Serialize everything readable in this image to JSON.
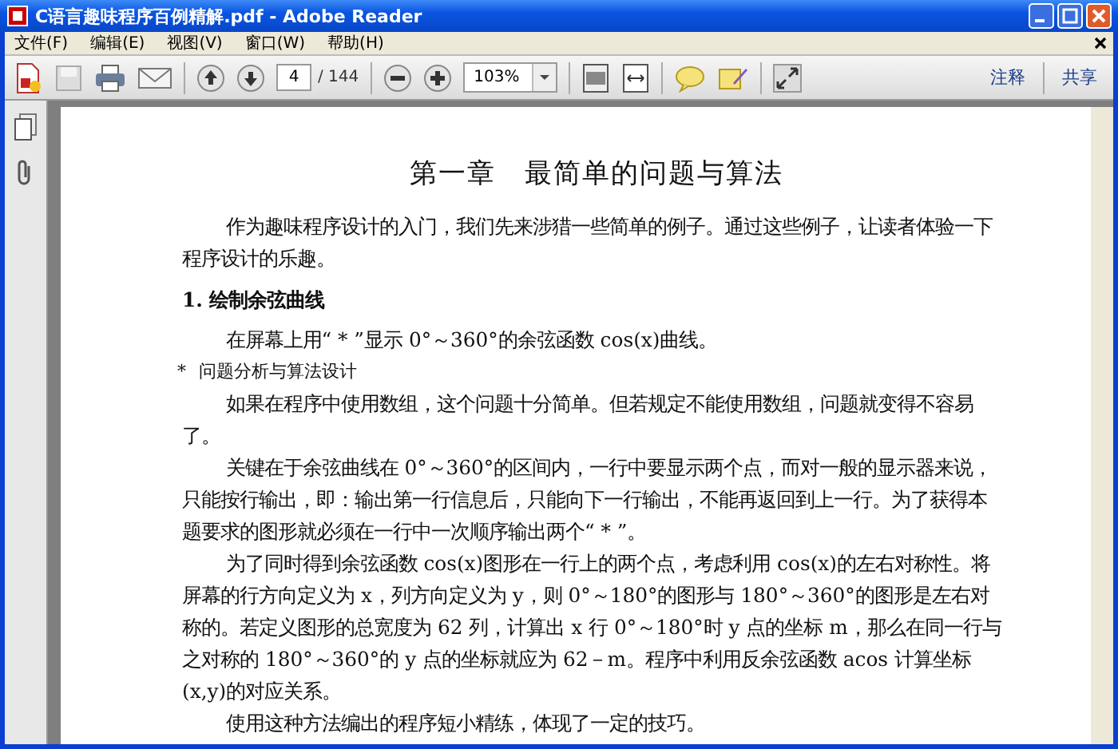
{
  "window": {
    "title": "C语言趣味程序百例精解.pdf - Adobe Reader"
  },
  "menu": [
    "文件(F)",
    "编辑(E)",
    "视图(V)",
    "窗口(W)",
    "帮助(H)"
  ],
  "toolbar": {
    "page_number": "4",
    "page_total": "/ 144",
    "zoom": "103%",
    "panel_buttons": [
      "注释",
      "共享"
    ]
  },
  "document": {
    "title": "第一章　最简单的问题与算法",
    "blocks": [
      {
        "kind": "paragraph",
        "text": "作为趣味程序设计的入门，我们先来涉猎一些简单的例子。通过这些例子，让读者体验一下程序设计的乐趣。"
      },
      {
        "kind": "heading",
        "text": "1. 绘制余弦曲线"
      },
      {
        "kind": "paragraph",
        "text": "在屏幕上用“ * ”显示 0°～360°的余弦函数 cos(x)曲线。"
      },
      {
        "kind": "bullet",
        "marker": "*",
        "text": "问题分析与算法设计"
      },
      {
        "kind": "paragraph",
        "text": "如果在程序中使用数组，这个问题十分简单。但若规定不能使用数组，问题就变得不容易了。"
      },
      {
        "kind": "paragraph",
        "text": "关键在于余弦曲线在 0°～360°的区间内，一行中要显示两个点，而对一般的显示器来说，只能按行输出，即：输出第一行信息后，只能向下一行输出，不能再返回到上一行。为了获得本题要求的图形就必须在一行中一次顺序输出两个“ * ”。"
      },
      {
        "kind": "paragraph",
        "text": "为了同时得到余弦函数 cos(x)图形在一行上的两个点，考虑利用 cos(x)的左右对称性。将屏幕的行方向定义为 x，列方向定义为 y，则 0°～180°的图形与 180°～360°的图形是左右对称的。若定义图形的总宽度为 62 列，计算出 x 行 0°～180°时 y 点的坐标 m，那么在同一行与之对称的 180°～360°的 y 点的坐标就应为 62－m。程序中利用反余弦函数 acos 计算坐标(x,y)的对应关系。"
      },
      {
        "kind": "paragraph",
        "text": "使用这种方法编出的程序短小精练，体现了一定的技巧。"
      }
    ]
  }
}
